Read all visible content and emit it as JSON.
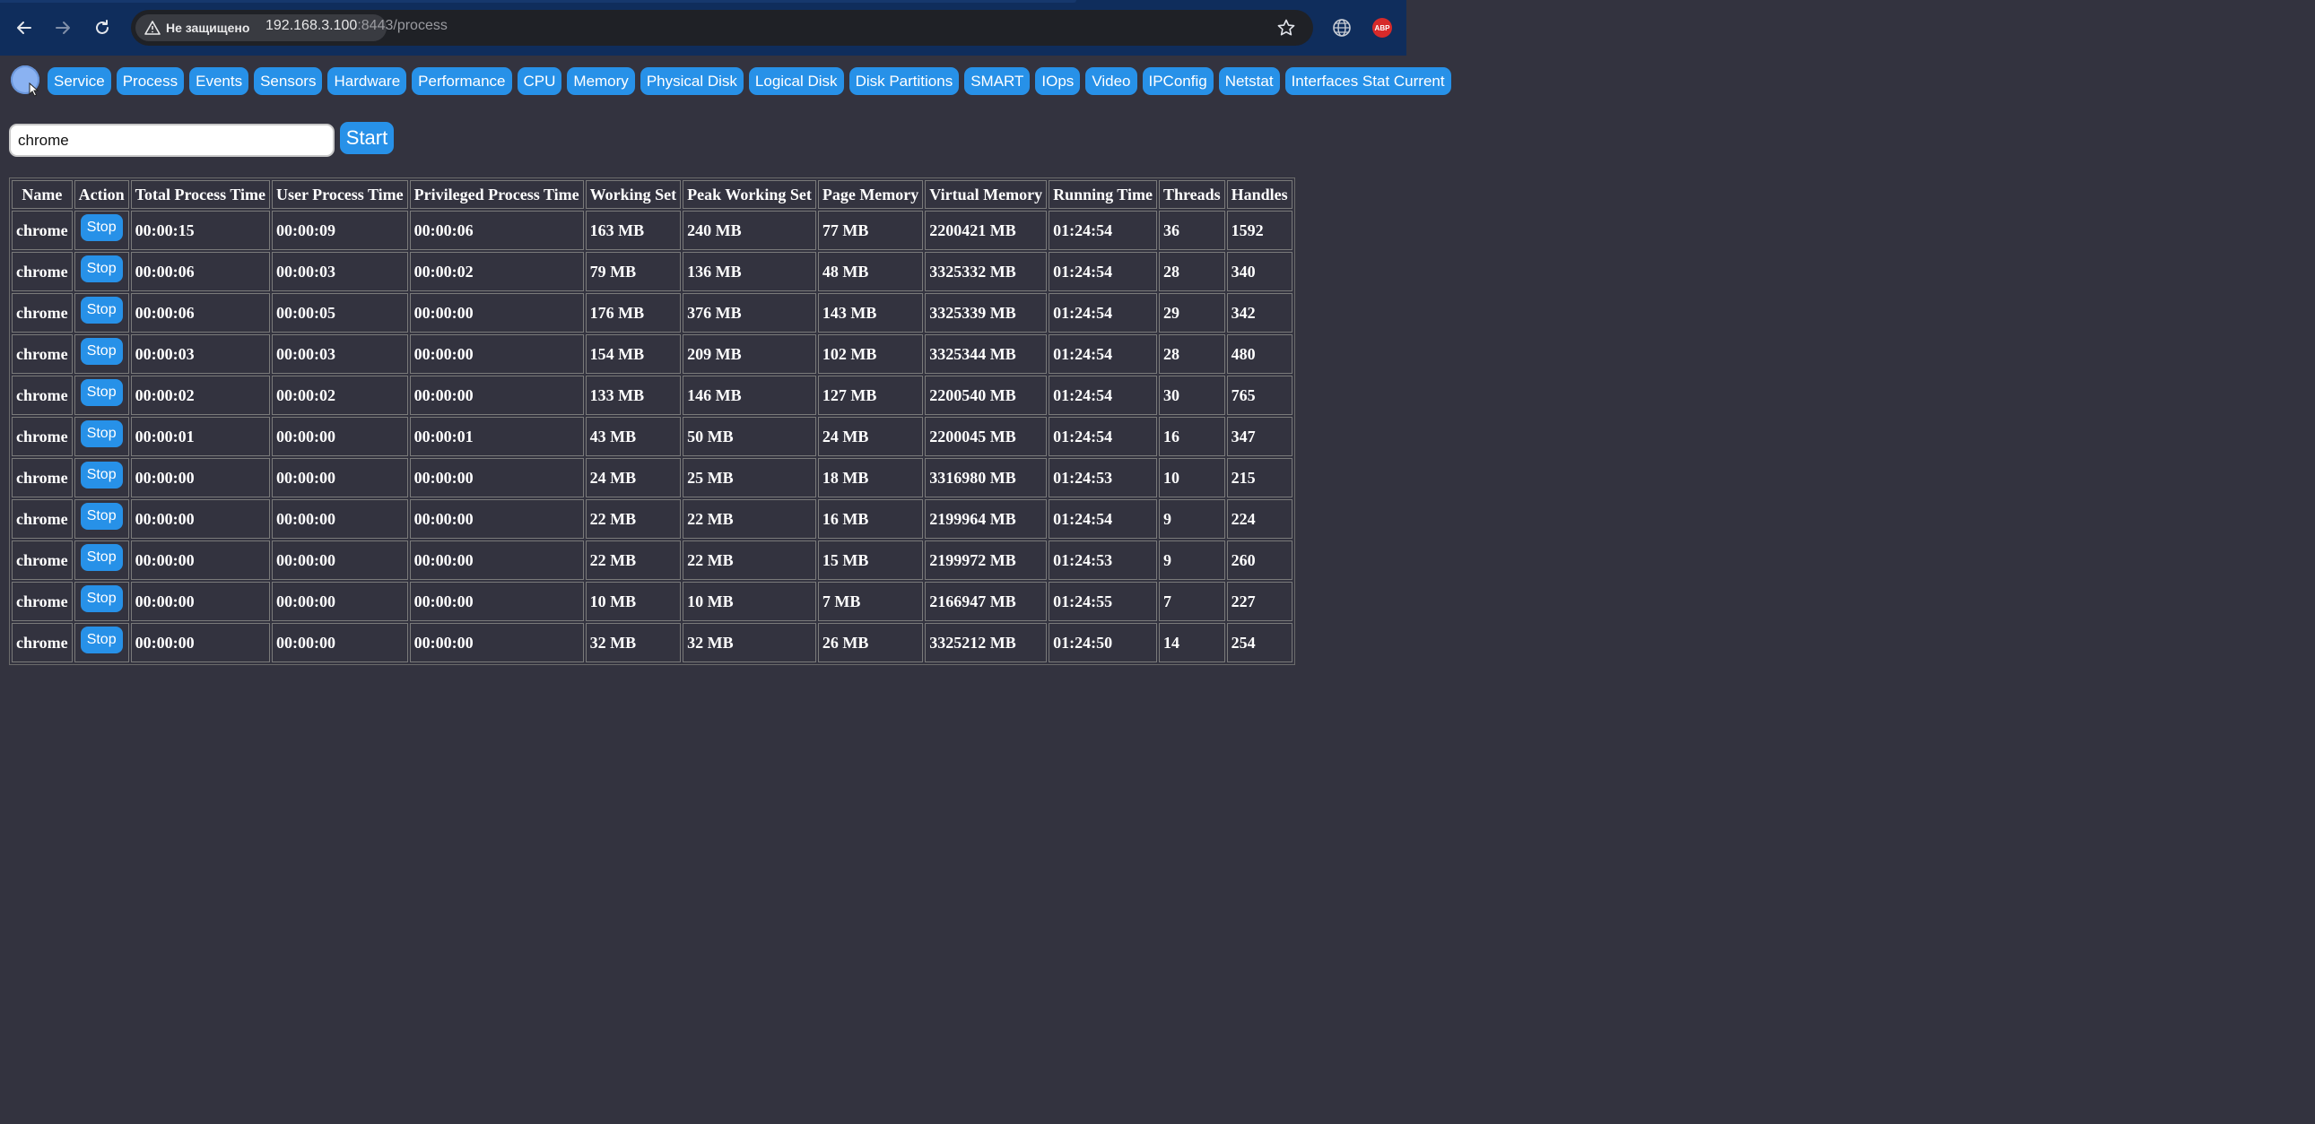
{
  "browser": {
    "security_label": "Не защищено",
    "url_host": "192.168.3.100",
    "url_port_path": ":8443/process",
    "extensions": {
      "abp_label": "ABP"
    }
  },
  "colors": {
    "accent": "#2791e8",
    "page_bg": "#33333f",
    "browser_bar": "#0f2d5c"
  },
  "nav": {
    "items": [
      "Service",
      "Process",
      "Events",
      "Sensors",
      "Hardware",
      "Performance",
      "CPU",
      "Memory",
      "Physical Disk",
      "Logical Disk",
      "Disk Partitions",
      "SMART",
      "IOps",
      "Video",
      "IPConfig",
      "Netstat",
      "Interfaces Stat Current"
    ]
  },
  "search": {
    "value": "chrome",
    "button_label": "Start"
  },
  "table": {
    "headers": [
      "Name",
      "Action",
      "Total Process Time",
      "User Process Time",
      "Privileged Process Time",
      "Working Set",
      "Peak Working Set",
      "Page Memory",
      "Virtual Memory",
      "Running Time",
      "Threads",
      "Handles"
    ],
    "action_label": "Stop",
    "rows": [
      [
        "chrome",
        "00:00:15",
        "00:00:09",
        "00:00:06",
        "163 MB",
        "240 MB",
        "77 MB",
        "2200421 MB",
        "01:24:54",
        "36",
        "1592"
      ],
      [
        "chrome",
        "00:00:06",
        "00:00:03",
        "00:00:02",
        "79 MB",
        "136 MB",
        "48 MB",
        "3325332 MB",
        "01:24:54",
        "28",
        "340"
      ],
      [
        "chrome",
        "00:00:06",
        "00:00:05",
        "00:00:00",
        "176 MB",
        "376 MB",
        "143 MB",
        "3325339 MB",
        "01:24:54",
        "29",
        "342"
      ],
      [
        "chrome",
        "00:00:03",
        "00:00:03",
        "00:00:00",
        "154 MB",
        "209 MB",
        "102 MB",
        "3325344 MB",
        "01:24:54",
        "28",
        "480"
      ],
      [
        "chrome",
        "00:00:02",
        "00:00:02",
        "00:00:00",
        "133 MB",
        "146 MB",
        "127 MB",
        "2200540 MB",
        "01:24:54",
        "30",
        "765"
      ],
      [
        "chrome",
        "00:00:01",
        "00:00:00",
        "00:00:01",
        "43 MB",
        "50 MB",
        "24 MB",
        "2200045 MB",
        "01:24:54",
        "16",
        "347"
      ],
      [
        "chrome",
        "00:00:00",
        "00:00:00",
        "00:00:00",
        "24 MB",
        "25 MB",
        "18 MB",
        "3316980 MB",
        "01:24:53",
        "10",
        "215"
      ],
      [
        "chrome",
        "00:00:00",
        "00:00:00",
        "00:00:00",
        "22 MB",
        "22 MB",
        "16 MB",
        "2199964 MB",
        "01:24:54",
        "9",
        "224"
      ],
      [
        "chrome",
        "00:00:00",
        "00:00:00",
        "00:00:00",
        "22 MB",
        "22 MB",
        "15 MB",
        "2199972 MB",
        "01:24:53",
        "9",
        "260"
      ],
      [
        "chrome",
        "00:00:00",
        "00:00:00",
        "00:00:00",
        "10 MB",
        "10 MB",
        "7 MB",
        "2166947 MB",
        "01:24:55",
        "7",
        "227"
      ],
      [
        "chrome",
        "00:00:00",
        "00:00:00",
        "00:00:00",
        "32 MB",
        "32 MB",
        "26 MB",
        "3325212 MB",
        "01:24:50",
        "14",
        "254"
      ]
    ]
  }
}
